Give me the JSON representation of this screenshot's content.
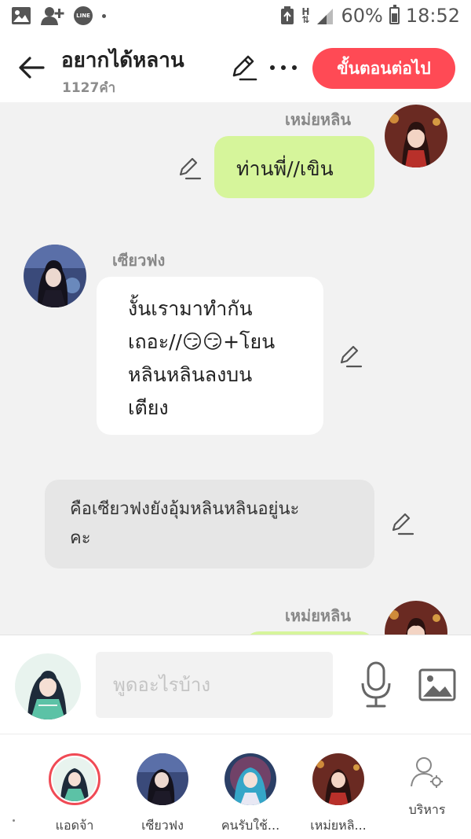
{
  "status_bar": {
    "battery": "60%",
    "time": "18:52",
    "battery_level": 0.6,
    "icons": [
      "gallery-icon",
      "add-contact-icon",
      "line-app-icon",
      "notification-dot",
      "recycle-icon",
      "h-network-icon",
      "signal-icon",
      "battery-icon"
    ]
  },
  "header": {
    "title": "อยากได้หลาน",
    "word_count": "1127คำ",
    "next_label": "ขั้นตอนต่อไป",
    "accent_color": "#ff4a55"
  },
  "messages": [
    {
      "speaker": "เหม่ยหลิน",
      "side": "right",
      "style": "green",
      "lines": [
        "ท่านพี่//เขิน"
      ]
    },
    {
      "speaker": "เซียวฟง",
      "side": "left",
      "style": "white",
      "lines": [
        "งั้นเรามาทำกัน",
        "เถอะ//😏😏+โยน",
        "หลินหลินลงบน",
        "เตียง"
      ]
    },
    {
      "speaker": "",
      "side": "left",
      "style": "narration",
      "lines": [
        "คือเซียวฟงยังอุ้มหลินหลินอยู่นะ",
        "คะ"
      ]
    },
    {
      "speaker": "เหม่ยหลิน",
      "side": "right",
      "style": "green",
      "lines": []
    }
  ],
  "input": {
    "placeholder": "พูดอะไรบ้าง",
    "value": ""
  },
  "characters": [
    {
      "name": "แอดจ้า",
      "selected": true
    },
    {
      "name": "เซียวฟง",
      "selected": false
    },
    {
      "name": "คนรับใช้...",
      "selected": false
    },
    {
      "name": "เหม่ยหลิ...",
      "selected": false
    }
  ],
  "manage_label": "บริหาร",
  "colors": {
    "green_bubble": "#d6f59b",
    "white_bubble": "#ffffff",
    "narration_bubble": "#e6e6e6",
    "selected_ring": "#f04a55"
  }
}
